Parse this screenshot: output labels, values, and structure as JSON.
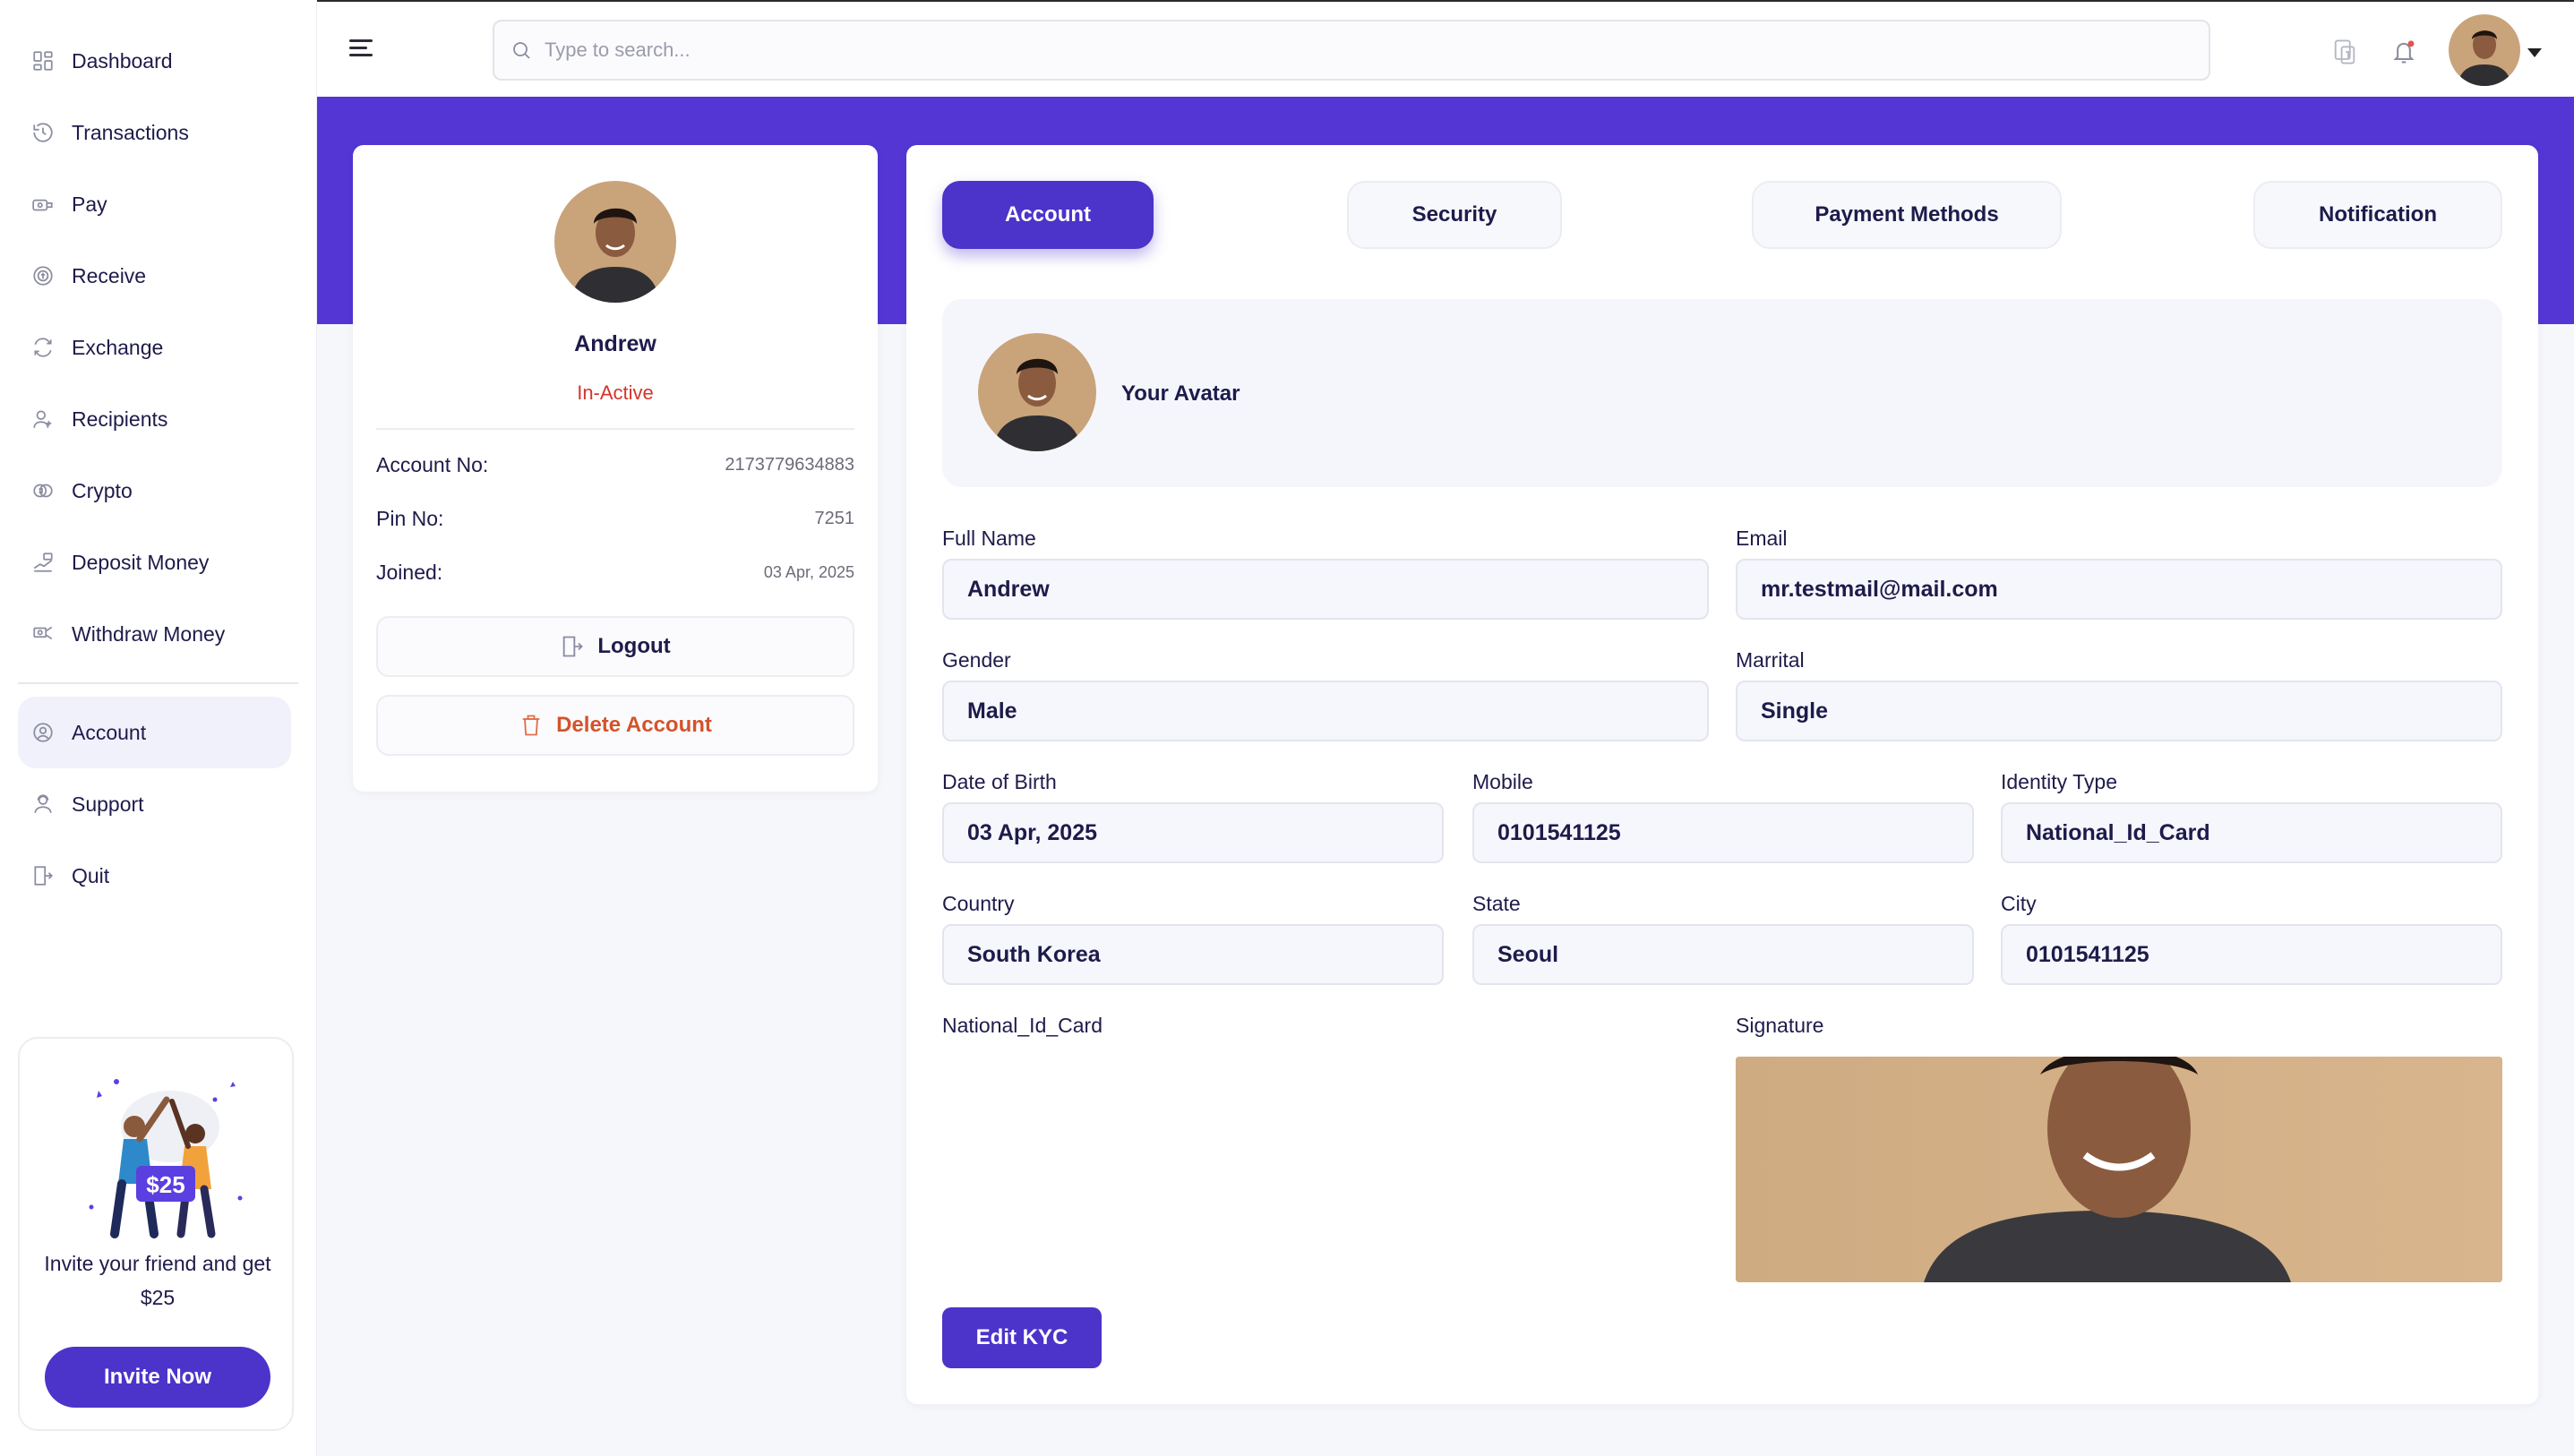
{
  "sidebar": {
    "items": [
      {
        "label": "Dashboard",
        "icon": "dashboard-icon"
      },
      {
        "label": "Transactions",
        "icon": "history-icon"
      },
      {
        "label": "Pay",
        "icon": "pay-icon"
      },
      {
        "label": "Receive",
        "icon": "receive-icon"
      },
      {
        "label": "Exchange",
        "icon": "exchange-icon"
      },
      {
        "label": "Recipients",
        "icon": "recipients-icon"
      },
      {
        "label": "Crypto",
        "icon": "crypto-icon"
      },
      {
        "label": "Deposit Money",
        "icon": "deposit-icon"
      },
      {
        "label": "Withdraw Money",
        "icon": "withdraw-icon"
      }
    ],
    "account_items": [
      {
        "label": "Account",
        "icon": "user-circle-icon",
        "active": true
      },
      {
        "label": "Support",
        "icon": "support-icon"
      },
      {
        "label": "Quit",
        "icon": "quit-icon"
      }
    ],
    "invite": {
      "amount": "$25",
      "text": "Invite your friend and get $25",
      "button": "Invite Now"
    }
  },
  "topbar": {
    "search_placeholder": "Type to search..."
  },
  "profile": {
    "name": "Andrew",
    "status": "In-Active",
    "account_no_label": "Account No:",
    "account_no": "2173779634883",
    "pin_label": "Pin No:",
    "pin": "7251",
    "joined_label": "Joined:",
    "joined": "03 Apr, 2025",
    "logout": "Logout",
    "delete": "Delete Account"
  },
  "tabs": [
    "Account",
    "Security",
    "Payment Methods",
    "Notification"
  ],
  "account": {
    "avatar_label": "Your Avatar",
    "full_name_label": "Full Name",
    "full_name": "Andrew",
    "email_label": "Email",
    "email": "mr.testmail@mail.com",
    "gender_label": "Gender",
    "gender": "Male",
    "marital_label": "Marrital",
    "marital": "Single",
    "dob_label": "Date of Birth",
    "dob": "03 Apr, 2025",
    "mobile_label": "Mobile",
    "mobile": "0101541125",
    "identity_label": "Identity Type",
    "identity": "National_Id_Card",
    "country_label": "Country",
    "country": "South Korea",
    "state_label": "State",
    "state": "Seoul",
    "city_label": "City",
    "city": "0101541125",
    "national_id_label": "National_Id_Card",
    "signature_label": "Signature",
    "edit_kyc": "Edit KYC"
  },
  "colors": {
    "brand": "#4c33c9",
    "band": "#5336d4",
    "danger": "#d4352b"
  }
}
